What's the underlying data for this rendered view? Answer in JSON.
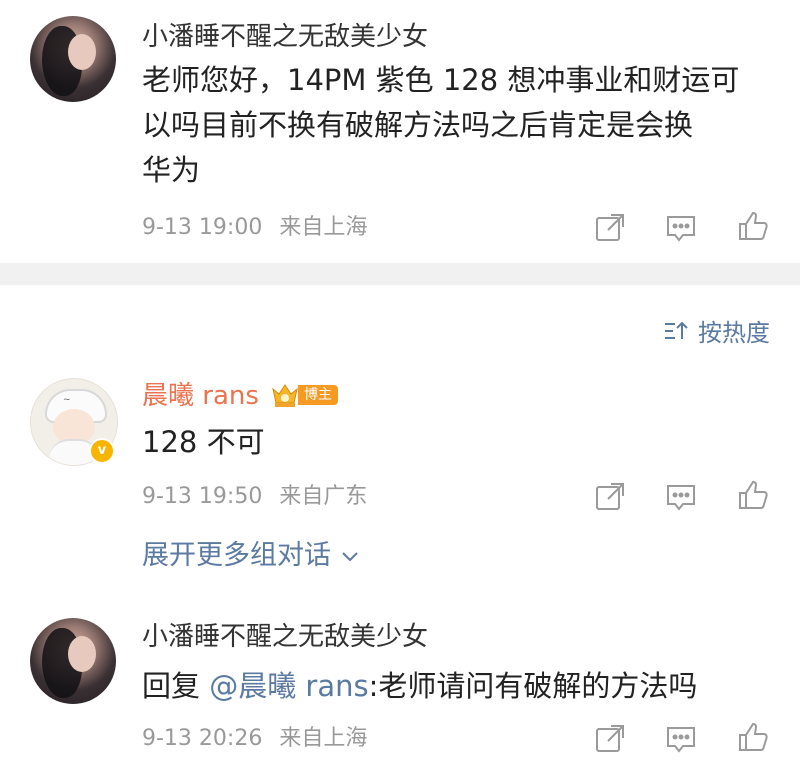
{
  "comment1": {
    "username": "小潘睡不醒之无敌美少女",
    "text_line1": "老师您好，14PM 紫色 128 想冲事业和财运可",
    "text_line2": "以吗目前不换有破解方法吗之后肯定是会换",
    "text_line3": "华为",
    "time": "9-13 19:00",
    "location": "来自上海"
  },
  "sort": {
    "label": "按热度",
    "icon": "sort-icon"
  },
  "reply1": {
    "username": "晨曦 rans",
    "badge_label": "博主",
    "text": "128 不可",
    "time": "9-13 19:50",
    "location": "来自广东"
  },
  "expand": {
    "label": "展开更多组对话"
  },
  "comment2": {
    "username": "小潘睡不醒之无敌美少女",
    "reply_prefix": "回复 ",
    "mention": "@晨曦 rans",
    "text": ":老师请问有破解的方法吗",
    "time": "9-13 20:26",
    "location": "来自上海"
  },
  "colors": {
    "link": "#5b7aa2",
    "orange_name": "#eb7350",
    "meta": "#999999",
    "badge": "#f59a23",
    "divider": "#f1f1f1"
  }
}
